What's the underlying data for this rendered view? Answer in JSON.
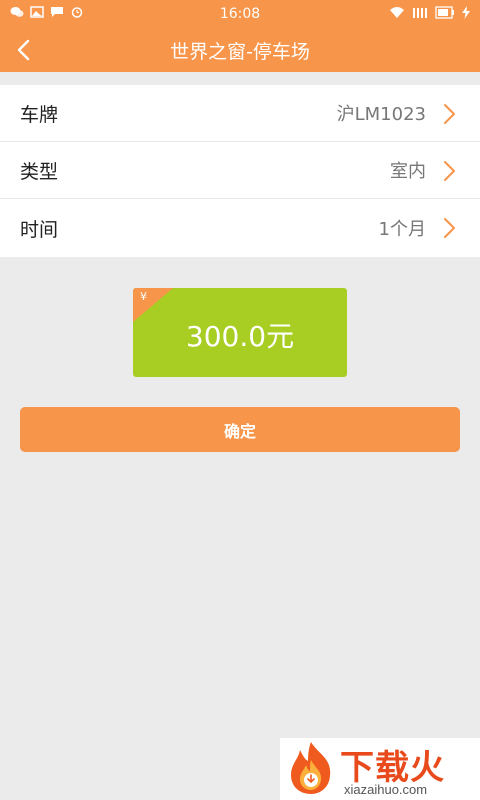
{
  "status_bar": {
    "time": "16:08"
  },
  "header": {
    "title": "世界之窗-停车场",
    "back_icon": "chevron-left-icon"
  },
  "form": {
    "rows": [
      {
        "label": "车牌",
        "value": "沪LM1023"
      },
      {
        "label": "类型",
        "value": "室内"
      },
      {
        "label": "时间",
        "value": "1个月"
      }
    ]
  },
  "price_card": {
    "currency_symbol": "¥",
    "amount": "300.0元"
  },
  "confirm_button": {
    "label": "确定"
  },
  "watermark": {
    "brand": "下载火",
    "url": "xiazaihuo.com"
  },
  "colors": {
    "accent": "#f7954a",
    "price_card": "#a8cd23",
    "background": "#ebebeb"
  }
}
